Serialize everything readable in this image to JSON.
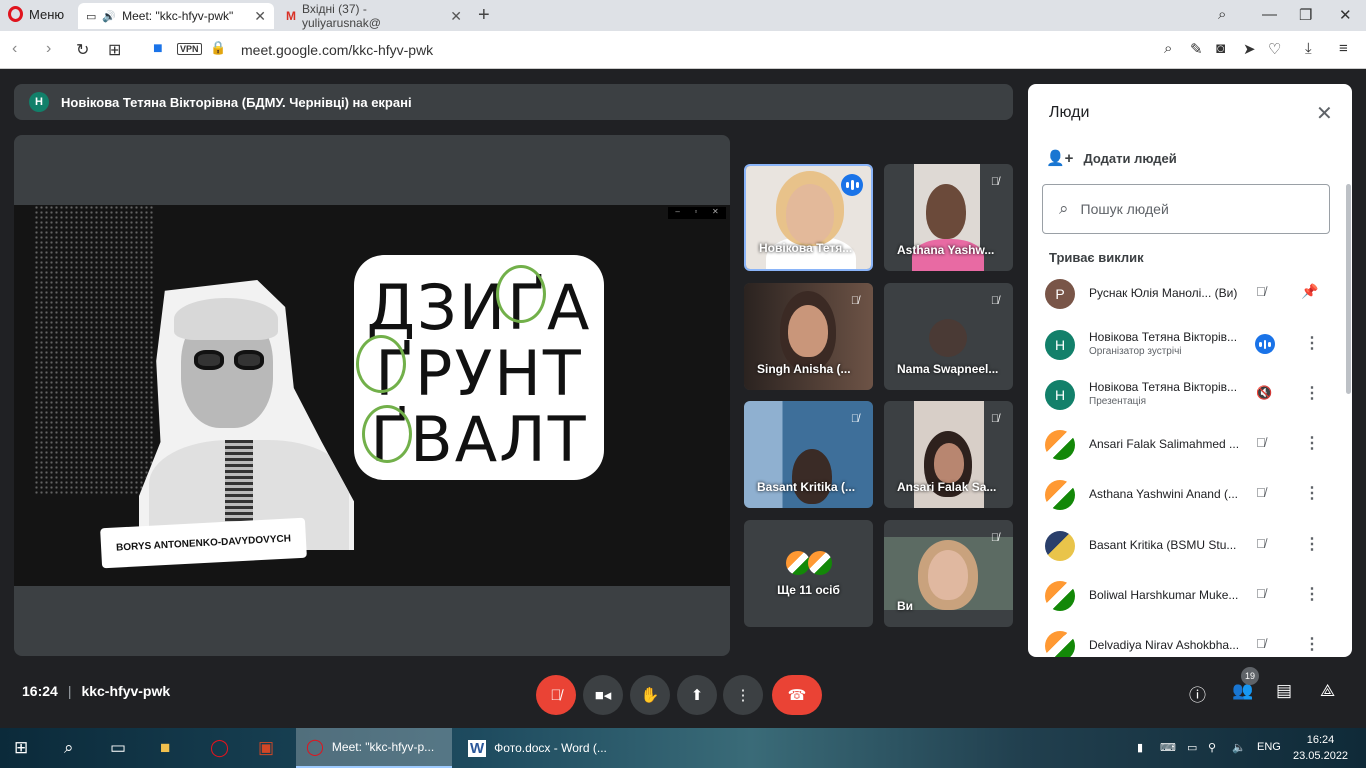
{
  "browser": {
    "menu_label": "Меню",
    "tabs": [
      {
        "title": "Meet: \"kkc-hfyv-pwk\"",
        "active": true
      },
      {
        "title": "Вхідні (37) - yuliyarusnak@",
        "active": false
      }
    ],
    "url": "meet.google.com/kkc-hfyv-pwk",
    "vpn_label": "VPN"
  },
  "meet": {
    "presenting_banner": {
      "avatar_letter": "Н",
      "text": "Новікова Тетяна Вікторівна (БДМУ. Чернівці) на екрані"
    },
    "shared_screen": {
      "words": [
        "ДЗИҐА",
        "ҐРУНТ",
        "ҐВАЛТ"
      ],
      "caption": "BORYS ANTONENKO-DAVYDOVYCH"
    },
    "tiles": [
      {
        "label": "Новікова Тетя...",
        "speaking": true
      },
      {
        "label": "Asthana Yashw...",
        "muted": true
      },
      {
        "label": "Singh Anisha (...",
        "muted": true
      },
      {
        "label": "Nama Swapneel...",
        "muted": true
      },
      {
        "label": "Basant Kritika (...",
        "muted": true
      },
      {
        "label": "Ansari Falak Sa...",
        "muted": true
      },
      {
        "label": "Ще 11 осіб"
      },
      {
        "label": "Ви",
        "muted": true
      }
    ],
    "meeting_time": "16:24",
    "meeting_code": "kkc-hfyv-pwk",
    "participant_count": "19"
  },
  "people_panel": {
    "title": "Люди",
    "add_people": "Додати людей",
    "search_placeholder": "Пошук людей",
    "section": "Триває виклик",
    "rows": [
      {
        "avatar": "Р",
        "name": "Руснак Юлія Манолі... (Ви)",
        "sub": ""
      },
      {
        "avatar": "Н",
        "name": "Новікова Тетяна Вікторів...",
        "sub": "Організатор зустрічі"
      },
      {
        "avatar": "Н",
        "name": "Новікова Тетяна Вікторів...",
        "sub": "Презентація"
      },
      {
        "avatar": "",
        "name": "Ansari Falak Salimahmed ...",
        "sub": ""
      },
      {
        "avatar": "",
        "name": "Asthana Yashwini Anand (...",
        "sub": ""
      },
      {
        "avatar": "",
        "name": "Basant Kritika (BSMU Stu...",
        "sub": ""
      },
      {
        "avatar": "",
        "name": "Boliwal Harshkumar Muke...",
        "sub": ""
      },
      {
        "avatar": "",
        "name": "Delvadiya Nirav Ashokbha...",
        "sub": ""
      }
    ]
  },
  "taskbar": {
    "apps": [
      {
        "title": "Meet: \"kkc-hfyv-p...",
        "active": true
      },
      {
        "title": "Фото.docx - Word (...",
        "active": false
      }
    ],
    "language": "ENG",
    "time": "16:24",
    "date": "23.05.2022"
  },
  "colors": {
    "accent": "#1a73e8",
    "end_call": "#ea4335",
    "avatar_green": "#12806a",
    "avatar_brown": "#795548"
  }
}
